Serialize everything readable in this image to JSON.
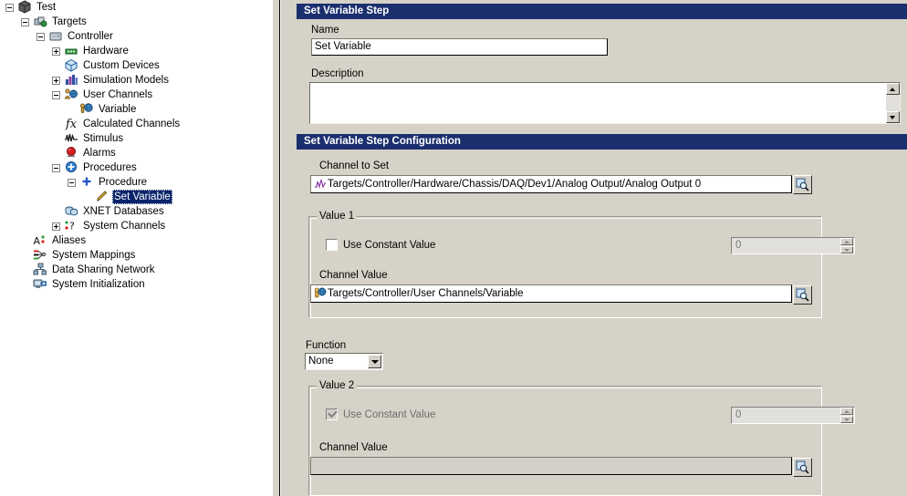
{
  "tree": {
    "items": [
      {
        "label": "Test",
        "depth": 0,
        "expander": "minus",
        "icon": "project-cube-icon"
      },
      {
        "label": "Targets",
        "depth": 1,
        "expander": "minus",
        "icon": "targets-icon"
      },
      {
        "label": "Controller",
        "depth": 2,
        "expander": "minus",
        "icon": "controller-icon"
      },
      {
        "label": "Hardware",
        "depth": 3,
        "expander": "plus",
        "icon": "hardware-icon"
      },
      {
        "label": "Custom Devices",
        "depth": 3,
        "expander": "none",
        "icon": "custom-devices-icon"
      },
      {
        "label": "Simulation Models",
        "depth": 3,
        "expander": "plus",
        "icon": "simulation-models-icon"
      },
      {
        "label": "User Channels",
        "depth": 3,
        "expander": "minus",
        "icon": "user-channels-icon"
      },
      {
        "label": "Variable",
        "depth": 4,
        "expander": "none",
        "icon": "variable-icon"
      },
      {
        "label": "Calculated Channels",
        "depth": 3,
        "expander": "none",
        "icon": "calculated-channels-icon"
      },
      {
        "label": "Stimulus",
        "depth": 3,
        "expander": "none",
        "icon": "stimulus-icon"
      },
      {
        "label": "Alarms",
        "depth": 3,
        "expander": "none",
        "icon": "alarms-icon"
      },
      {
        "label": "Procedures",
        "depth": 3,
        "expander": "minus",
        "icon": "procedures-icon"
      },
      {
        "label": "Procedure",
        "depth": 4,
        "expander": "minus",
        "icon": "procedure-icon"
      },
      {
        "label": "Set Variable",
        "depth": 5,
        "expander": "none",
        "icon": "set-variable-step-icon",
        "selected": true
      },
      {
        "label": "XNET Databases",
        "depth": 3,
        "expander": "none",
        "icon": "xnet-databases-icon"
      },
      {
        "label": "System Channels",
        "depth": 3,
        "expander": "plus",
        "icon": "system-channels-icon"
      },
      {
        "label": "Aliases",
        "depth": 1,
        "expander": "none",
        "icon": "aliases-icon"
      },
      {
        "label": "System Mappings",
        "depth": 1,
        "expander": "none",
        "icon": "system-mappings-icon"
      },
      {
        "label": "Data Sharing Network",
        "depth": 1,
        "expander": "none",
        "icon": "data-sharing-network-icon"
      },
      {
        "label": "System Initialization",
        "depth": 1,
        "expander": "none",
        "icon": "system-initialization-icon"
      }
    ]
  },
  "step_panel": {
    "header": "Set Variable Step",
    "name_label": "Name",
    "name_value": "Set Variable",
    "description_label": "Description",
    "description_value": ""
  },
  "config_panel": {
    "header": "Set Variable Step Configuration",
    "channel_to_set_label": "Channel to Set",
    "channel_to_set_value": "Targets/Controller/Hardware/Chassis/DAQ/Dev1/Analog Output/Analog Output 0",
    "browse_icon": "browse-magnifier-icon",
    "value1": {
      "group_title": "Value 1",
      "use_constant_label": "Use Constant Value",
      "use_constant_checked": false,
      "constant_value": "0",
      "channel_value_label": "Channel Value",
      "channel_value": "Targets/Controller/User Channels/Variable"
    },
    "function": {
      "label": "Function",
      "selected": "None",
      "options": [
        "None"
      ]
    },
    "value2": {
      "group_title": "Value 2",
      "use_constant_label": "Use Constant Value",
      "use_constant_checked": true,
      "constant_value": "0",
      "channel_value_label": "Channel Value",
      "channel_value": ""
    }
  },
  "colors": {
    "header_blue": "#1b2f6e",
    "panel_gray": "#d6d2c8",
    "selection_blue": "#0a246a",
    "field_white": "#ffffff",
    "disabled_gray": "#d4d0c8"
  }
}
